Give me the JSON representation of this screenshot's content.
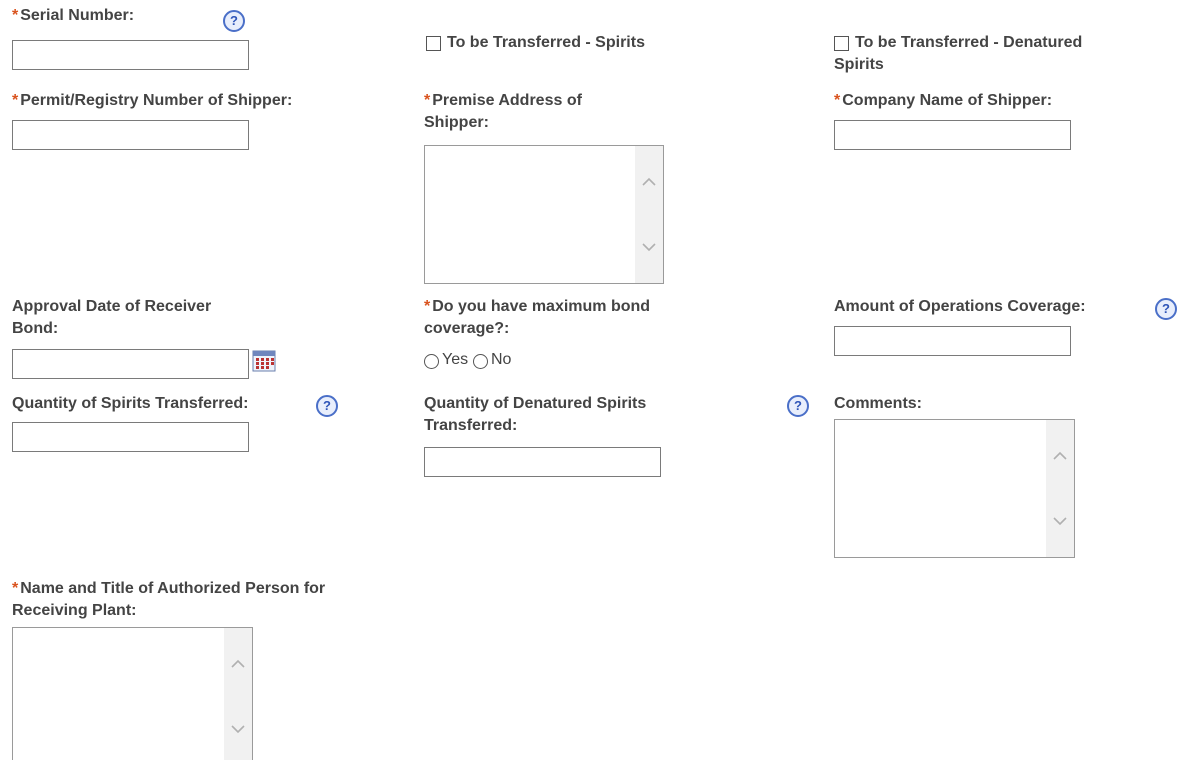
{
  "fields": {
    "serial_number": {
      "label": "Serial Number:",
      "value": ""
    },
    "transfer_spirits": {
      "label": "To be Transferred - Spirits"
    },
    "transfer_denatured": {
      "label_line1": "To be Transferred - Denatured",
      "label_line2": "Spirits"
    },
    "permit_registry": {
      "label": "Permit/Registry Number of Shipper:",
      "value": ""
    },
    "premise_address": {
      "label_line1": "Premise Address of",
      "label_line2": "Shipper:"
    },
    "company_name": {
      "label": "Company Name of Shipper:",
      "value": ""
    },
    "approval_date": {
      "label_line1": "Approval Date of Receiver",
      "label_line2": "Bond:",
      "value": ""
    },
    "max_bond": {
      "label_line1": "Do you have maximum bond",
      "label_line2": "coverage?:",
      "options": [
        "Yes",
        "No"
      ]
    },
    "operations_coverage": {
      "label": "Amount of Operations Coverage:",
      "value": ""
    },
    "quantity_spirits": {
      "label": "Quantity of Spirits Transferred:",
      "value": ""
    },
    "quantity_denatured": {
      "label_line1": "Quantity of Denatured Spirits",
      "label_line2": "Transferred:",
      "value": ""
    },
    "comments": {
      "label": "Comments:"
    },
    "authorized_person": {
      "label_line1": "Name and Title of Authorized Person for",
      "label_line2": "Receiving Plant:"
    }
  },
  "required_marker": "*",
  "help_glyph": "?",
  "icons": {
    "help": "help-circle-icon",
    "calendar": "calendar-icon",
    "scroll_up": "chevron-up-icon",
    "scroll_down": "chevron-down-icon"
  },
  "colors": {
    "required": "#d9531e",
    "help": "#2f55b8",
    "label": "#444444"
  }
}
